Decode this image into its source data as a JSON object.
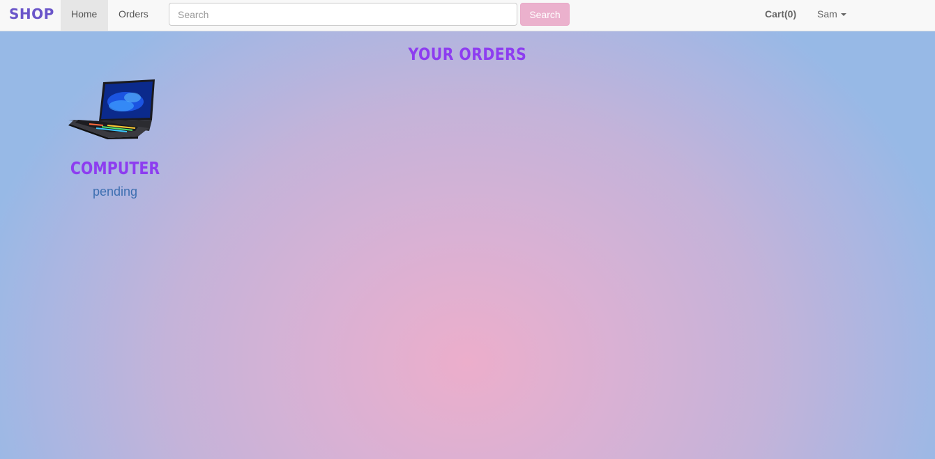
{
  "navbar": {
    "brand": "SHOP",
    "links": [
      {
        "label": "Home",
        "active": true
      },
      {
        "label": "Orders",
        "active": false
      }
    ],
    "search": {
      "placeholder": "Search",
      "value": "",
      "button_label": "Search"
    },
    "cart": {
      "label": "Cart(0)"
    },
    "user": {
      "label": "Sam"
    }
  },
  "main": {
    "heading": "YOUR ORDERS",
    "orders": [
      {
        "product_name": "COMPUTER",
        "status": "pending",
        "image": "laptop-image"
      }
    ]
  },
  "colors": {
    "brand": "#6a55c9",
    "heading": "#8d3df0",
    "status": "#3d6fb1",
    "search_button": "#ebb1cd",
    "background_center": "#ecaecb",
    "background_edge": "#97b9e6"
  }
}
